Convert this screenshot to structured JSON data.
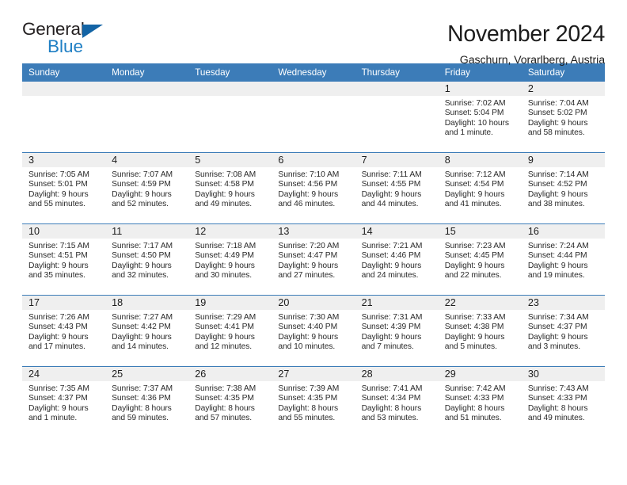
{
  "logo": {
    "word_one": "General",
    "word_two": "Blue",
    "triangle_color": "#1364a5",
    "blue_text_color": "#1f7fc4"
  },
  "header": {
    "title": "November 2024",
    "subtitle": "Gaschurn, Vorarlberg, Austria",
    "header_bg_color": "#3c7cb8",
    "daynum_band_color": "#efefef"
  },
  "calendar": {
    "weekdays": [
      "Sunday",
      "Monday",
      "Tuesday",
      "Wednesday",
      "Thursday",
      "Friday",
      "Saturday"
    ],
    "weeks": [
      [
        {
          "day": "",
          "empty": true
        },
        {
          "day": "",
          "empty": true
        },
        {
          "day": "",
          "empty": true
        },
        {
          "day": "",
          "empty": true
        },
        {
          "day": "",
          "empty": true
        },
        {
          "day": "1",
          "sunrise": "Sunrise: 7:02 AM",
          "sunset": "Sunset: 5:04 PM",
          "daylight_1": "Daylight: 10 hours",
          "daylight_2": "and 1 minute."
        },
        {
          "day": "2",
          "sunrise": "Sunrise: 7:04 AM",
          "sunset": "Sunset: 5:02 PM",
          "daylight_1": "Daylight: 9 hours",
          "daylight_2": "and 58 minutes."
        }
      ],
      [
        {
          "day": "3",
          "sunrise": "Sunrise: 7:05 AM",
          "sunset": "Sunset: 5:01 PM",
          "daylight_1": "Daylight: 9 hours",
          "daylight_2": "and 55 minutes."
        },
        {
          "day": "4",
          "sunrise": "Sunrise: 7:07 AM",
          "sunset": "Sunset: 4:59 PM",
          "daylight_1": "Daylight: 9 hours",
          "daylight_2": "and 52 minutes."
        },
        {
          "day": "5",
          "sunrise": "Sunrise: 7:08 AM",
          "sunset": "Sunset: 4:58 PM",
          "daylight_1": "Daylight: 9 hours",
          "daylight_2": "and 49 minutes."
        },
        {
          "day": "6",
          "sunrise": "Sunrise: 7:10 AM",
          "sunset": "Sunset: 4:56 PM",
          "daylight_1": "Daylight: 9 hours",
          "daylight_2": "and 46 minutes."
        },
        {
          "day": "7",
          "sunrise": "Sunrise: 7:11 AM",
          "sunset": "Sunset: 4:55 PM",
          "daylight_1": "Daylight: 9 hours",
          "daylight_2": "and 44 minutes."
        },
        {
          "day": "8",
          "sunrise": "Sunrise: 7:12 AM",
          "sunset": "Sunset: 4:54 PM",
          "daylight_1": "Daylight: 9 hours",
          "daylight_2": "and 41 minutes."
        },
        {
          "day": "9",
          "sunrise": "Sunrise: 7:14 AM",
          "sunset": "Sunset: 4:52 PM",
          "daylight_1": "Daylight: 9 hours",
          "daylight_2": "and 38 minutes."
        }
      ],
      [
        {
          "day": "10",
          "sunrise": "Sunrise: 7:15 AM",
          "sunset": "Sunset: 4:51 PM",
          "daylight_1": "Daylight: 9 hours",
          "daylight_2": "and 35 minutes."
        },
        {
          "day": "11",
          "sunrise": "Sunrise: 7:17 AM",
          "sunset": "Sunset: 4:50 PM",
          "daylight_1": "Daylight: 9 hours",
          "daylight_2": "and 32 minutes."
        },
        {
          "day": "12",
          "sunrise": "Sunrise: 7:18 AM",
          "sunset": "Sunset: 4:49 PM",
          "daylight_1": "Daylight: 9 hours",
          "daylight_2": "and 30 minutes."
        },
        {
          "day": "13",
          "sunrise": "Sunrise: 7:20 AM",
          "sunset": "Sunset: 4:47 PM",
          "daylight_1": "Daylight: 9 hours",
          "daylight_2": "and 27 minutes."
        },
        {
          "day": "14",
          "sunrise": "Sunrise: 7:21 AM",
          "sunset": "Sunset: 4:46 PM",
          "daylight_1": "Daylight: 9 hours",
          "daylight_2": "and 24 minutes."
        },
        {
          "day": "15",
          "sunrise": "Sunrise: 7:23 AM",
          "sunset": "Sunset: 4:45 PM",
          "daylight_1": "Daylight: 9 hours",
          "daylight_2": "and 22 minutes."
        },
        {
          "day": "16",
          "sunrise": "Sunrise: 7:24 AM",
          "sunset": "Sunset: 4:44 PM",
          "daylight_1": "Daylight: 9 hours",
          "daylight_2": "and 19 minutes."
        }
      ],
      [
        {
          "day": "17",
          "sunrise": "Sunrise: 7:26 AM",
          "sunset": "Sunset: 4:43 PM",
          "daylight_1": "Daylight: 9 hours",
          "daylight_2": "and 17 minutes."
        },
        {
          "day": "18",
          "sunrise": "Sunrise: 7:27 AM",
          "sunset": "Sunset: 4:42 PM",
          "daylight_1": "Daylight: 9 hours",
          "daylight_2": "and 14 minutes."
        },
        {
          "day": "19",
          "sunrise": "Sunrise: 7:29 AM",
          "sunset": "Sunset: 4:41 PM",
          "daylight_1": "Daylight: 9 hours",
          "daylight_2": "and 12 minutes."
        },
        {
          "day": "20",
          "sunrise": "Sunrise: 7:30 AM",
          "sunset": "Sunset: 4:40 PM",
          "daylight_1": "Daylight: 9 hours",
          "daylight_2": "and 10 minutes."
        },
        {
          "day": "21",
          "sunrise": "Sunrise: 7:31 AM",
          "sunset": "Sunset: 4:39 PM",
          "daylight_1": "Daylight: 9 hours",
          "daylight_2": "and 7 minutes."
        },
        {
          "day": "22",
          "sunrise": "Sunrise: 7:33 AM",
          "sunset": "Sunset: 4:38 PM",
          "daylight_1": "Daylight: 9 hours",
          "daylight_2": "and 5 minutes."
        },
        {
          "day": "23",
          "sunrise": "Sunrise: 7:34 AM",
          "sunset": "Sunset: 4:37 PM",
          "daylight_1": "Daylight: 9 hours",
          "daylight_2": "and 3 minutes."
        }
      ],
      [
        {
          "day": "24",
          "sunrise": "Sunrise: 7:35 AM",
          "sunset": "Sunset: 4:37 PM",
          "daylight_1": "Daylight: 9 hours",
          "daylight_2": "and 1 minute."
        },
        {
          "day": "25",
          "sunrise": "Sunrise: 7:37 AM",
          "sunset": "Sunset: 4:36 PM",
          "daylight_1": "Daylight: 8 hours",
          "daylight_2": "and 59 minutes."
        },
        {
          "day": "26",
          "sunrise": "Sunrise: 7:38 AM",
          "sunset": "Sunset: 4:35 PM",
          "daylight_1": "Daylight: 8 hours",
          "daylight_2": "and 57 minutes."
        },
        {
          "day": "27",
          "sunrise": "Sunrise: 7:39 AM",
          "sunset": "Sunset: 4:35 PM",
          "daylight_1": "Daylight: 8 hours",
          "daylight_2": "and 55 minutes."
        },
        {
          "day": "28",
          "sunrise": "Sunrise: 7:41 AM",
          "sunset": "Sunset: 4:34 PM",
          "daylight_1": "Daylight: 8 hours",
          "daylight_2": "and 53 minutes."
        },
        {
          "day": "29",
          "sunrise": "Sunrise: 7:42 AM",
          "sunset": "Sunset: 4:33 PM",
          "daylight_1": "Daylight: 8 hours",
          "daylight_2": "and 51 minutes."
        },
        {
          "day": "30",
          "sunrise": "Sunrise: 7:43 AM",
          "sunset": "Sunset: 4:33 PM",
          "daylight_1": "Daylight: 8 hours",
          "daylight_2": "and 49 minutes."
        }
      ]
    ]
  }
}
